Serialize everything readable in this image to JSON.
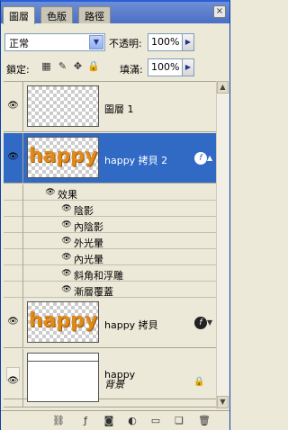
{
  "tabs": [
    {
      "label": "圖層",
      "active": true
    },
    {
      "label": "色版",
      "active": false
    },
    {
      "label": "路徑",
      "active": false
    }
  ],
  "close_button": "×",
  "blend": {
    "mode": "正常",
    "arrow": "▼"
  },
  "opacity": {
    "label": "不透明:",
    "value": "100%",
    "arrow": "▶"
  },
  "lock": {
    "label": "鎖定:",
    "icons": [
      "lock-transparency-icon",
      "lock-paint-icon",
      "lock-move-icon",
      "lock-all-icon"
    ]
  },
  "fill": {
    "label": "填滿:",
    "value": "100%",
    "arrow": "▶"
  },
  "layers": [
    {
      "name": "圖層 1",
      "visible": true,
      "thumb": "blank"
    },
    {
      "name": "happy 拷貝 2",
      "visible": true,
      "thumb": "happy",
      "selected": true,
      "fx": true
    },
    {
      "name": "happy 拷貝",
      "visible": true,
      "thumb": "happy",
      "fx": true
    },
    {
      "name": "happy",
      "visible": false,
      "thumb": "text"
    },
    {
      "name": "背景",
      "visible": true,
      "thumb": "white",
      "locked": true
    }
  ],
  "thumb_text": {
    "happy": "happy",
    "text": "T"
  },
  "effects": {
    "header": "效果",
    "items": [
      "陰影",
      "內陰影",
      "外光暈",
      "內光暈",
      "斜角和浮雕",
      "漸層覆蓋"
    ]
  },
  "fx_badge": "f",
  "colors": {
    "selection": "#316ac5",
    "panel": "#ece9d8",
    "title_bar": "#2a5fd6"
  },
  "bottom_tools": [
    "link-icon",
    "layer-style-icon",
    "mask-icon",
    "adjustment-layer-icon",
    "new-group-icon",
    "new-layer-icon",
    "trash-icon"
  ]
}
